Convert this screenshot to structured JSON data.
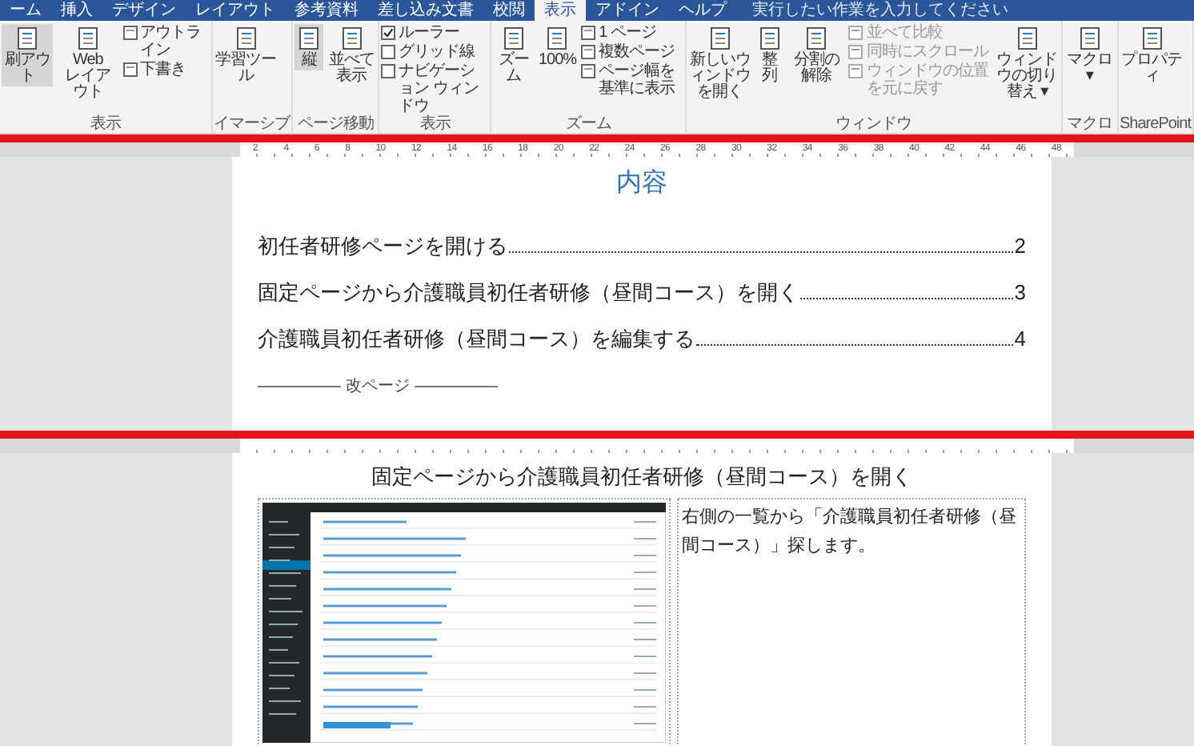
{
  "tabs": [
    {
      "label": "ーム",
      "selected": false
    },
    {
      "label": "挿入",
      "selected": false
    },
    {
      "label": "デザイン",
      "selected": false
    },
    {
      "label": "レイアウト",
      "selected": false
    },
    {
      "label": "参考資料",
      "selected": false
    },
    {
      "label": "差し込み文書",
      "selected": false
    },
    {
      "label": "校閲",
      "selected": false
    },
    {
      "label": "表示",
      "selected": true
    },
    {
      "label": "アドイン",
      "selected": false
    },
    {
      "label": "ヘルプ",
      "selected": false
    }
  ],
  "tell_me": "実行したい作業を入力してください",
  "ribbon": {
    "groups": [
      {
        "label": "表示",
        "items": [
          {
            "kind": "large",
            "label": "刷アウト",
            "selected": true
          },
          {
            "kind": "large",
            "label": "Web\nレイアウト",
            "selected": false
          },
          {
            "kind": "stack",
            "items": [
              {
                "label": "アウトライン"
              },
              {
                "label": "下書き"
              }
            ]
          }
        ]
      },
      {
        "label": "イマーシブ",
        "items": [
          {
            "kind": "large",
            "label": "学習ツール",
            "selected": false
          }
        ]
      },
      {
        "label": "ページ移動",
        "items": [
          {
            "kind": "large",
            "label": "縦",
            "selected": true
          },
          {
            "kind": "large",
            "label": "並べて表示",
            "selected": false
          }
        ]
      },
      {
        "label": "表示",
        "items": [
          {
            "kind": "checks",
            "items": [
              {
                "label": "ルーラー",
                "checked": true
              },
              {
                "label": "グリッド線",
                "checked": false
              },
              {
                "label": "ナビゲーション ウィンドウ",
                "checked": false
              }
            ]
          }
        ]
      },
      {
        "label": "ズーム",
        "items": [
          {
            "kind": "large",
            "label": "ズーム",
            "selected": false
          },
          {
            "kind": "large",
            "label": "100%",
            "selected": false
          },
          {
            "kind": "stack",
            "items": [
              {
                "label": "1 ページ"
              },
              {
                "label": "複数ページ"
              },
              {
                "label": "ページ幅を基準に表示"
              }
            ]
          }
        ]
      },
      {
        "label": "ウィンドウ",
        "items": [
          {
            "kind": "large",
            "label": "新しいウィンドウを開く",
            "selected": false
          },
          {
            "kind": "large",
            "label": "整列",
            "selected": false
          },
          {
            "kind": "large",
            "label": "分割の解除",
            "selected": false
          },
          {
            "kind": "stack",
            "disabled": true,
            "items": [
              {
                "label": "並べて比較"
              },
              {
                "label": "同時にスクロール"
              },
              {
                "label": "ウィンドウの位置を元に戻す"
              }
            ]
          },
          {
            "kind": "large",
            "label": "ウィンドウの切り替え ▾",
            "selected": false
          }
        ]
      },
      {
        "label": "マクロ",
        "items": [
          {
            "kind": "large",
            "label": "マクロ ▾",
            "selected": false
          }
        ]
      },
      {
        "label": "SharePoint",
        "items": [
          {
            "kind": "large",
            "label": "プロパティ",
            "selected": false
          }
        ]
      }
    ]
  },
  "ruler": {
    "numbers": [
      "2",
      "4",
      "6",
      "8",
      "10",
      "12",
      "14",
      "16",
      "18",
      "20",
      "22",
      "24",
      "26",
      "28",
      "30",
      "32",
      "34",
      "36",
      "38",
      "40",
      "42",
      "44",
      "46",
      "48"
    ]
  },
  "page_1": {
    "heading": "内容",
    "toc": [
      {
        "title": "初任者研修ページを開ける",
        "page": "2"
      },
      {
        "title": "固定ページから介護職員初任者研修（昼間コース）を開く",
        "page": "3"
      },
      {
        "title": "介護職員初任者研修（昼間コース）を編集する",
        "page": "4"
      }
    ],
    "page_break": "改ページ"
  },
  "page_2": {
    "heading": "固定ページから介護職員初任者研修（昼間コース）を開く",
    "note": "右側の一覧から「介護職員初任者研修（昼間コース）」探します。"
  }
}
